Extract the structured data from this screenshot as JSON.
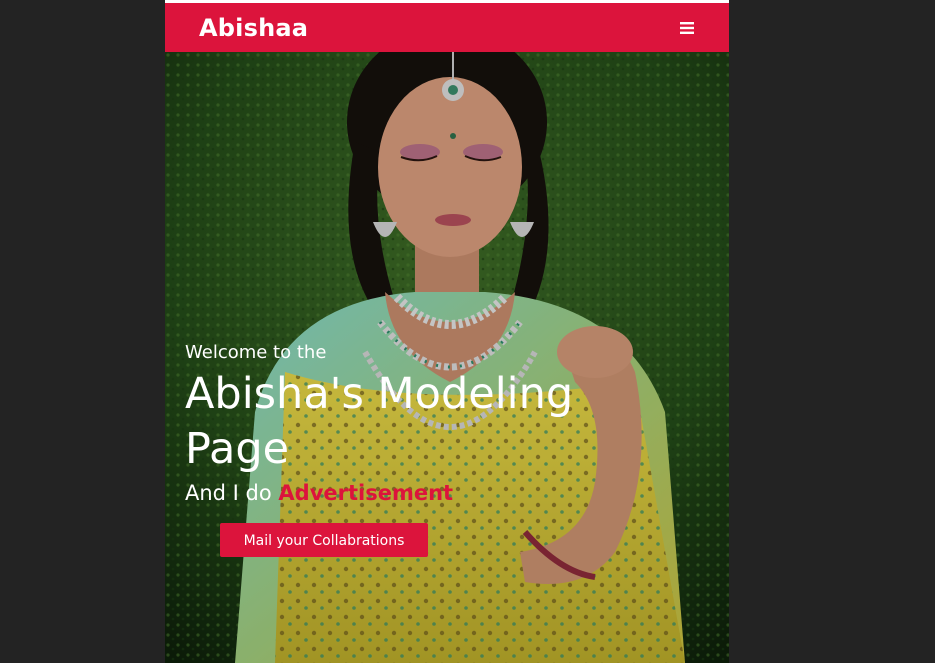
{
  "navbar": {
    "brand": "Abishaa",
    "menu_icon": "hamburger-menu-icon"
  },
  "hero": {
    "welcome": "Welcome to the",
    "headline": "Abisha's Modeling Page",
    "tagline_prefix": "And I do ",
    "tagline_accent": "Advertisement",
    "cta_label": "Mail your Collabrations"
  },
  "colors": {
    "accent": "#dc143c",
    "page_background": "#232323",
    "text": "#ffffff"
  }
}
